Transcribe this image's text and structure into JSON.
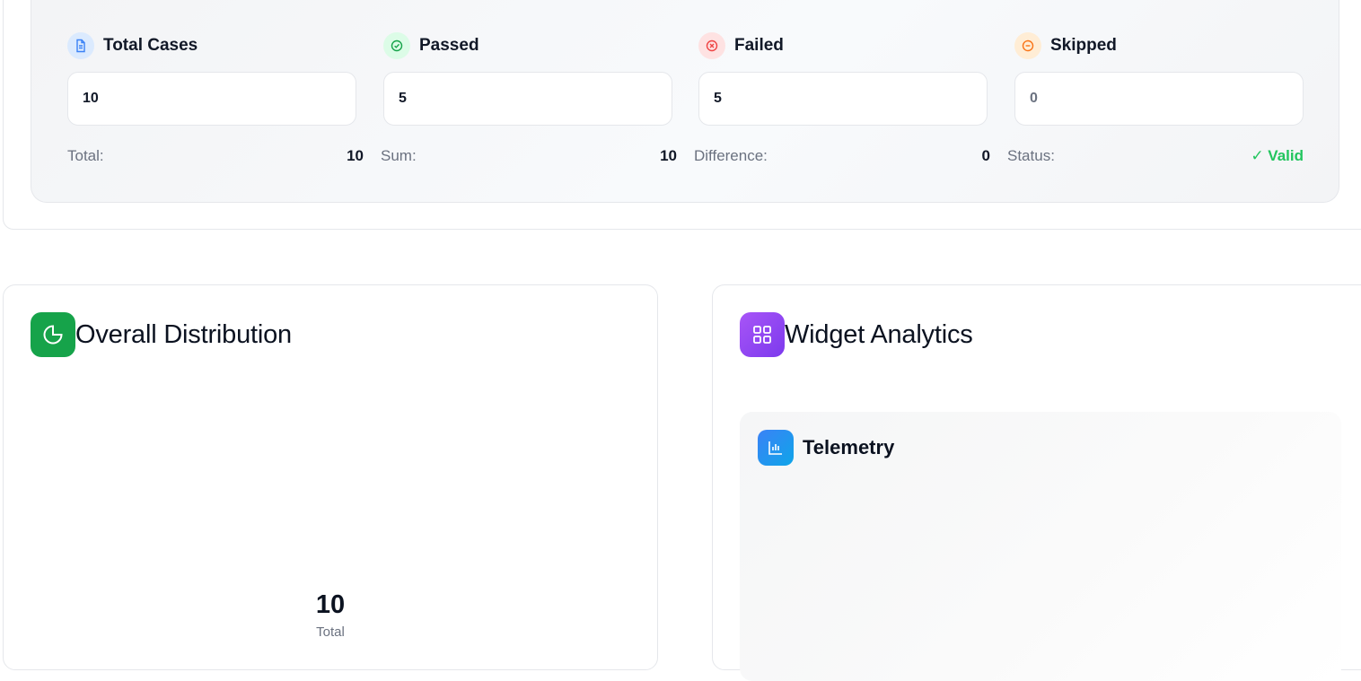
{
  "stats": [
    {
      "label": "Total Cases",
      "value": "10",
      "icon": "document-icon",
      "bg": "#dbeafe",
      "fg": "#3b82f6"
    },
    {
      "label": "Passed",
      "value": "5",
      "icon": "check-circle-icon",
      "bg": "#dcfce7",
      "fg": "#16a34a"
    },
    {
      "label": "Failed",
      "value": "5",
      "icon": "x-circle-icon",
      "bg": "#fee2e2",
      "fg": "#ef4444"
    },
    {
      "label": "Skipped",
      "value": "0",
      "icon": "minus-circle-icon",
      "bg": "#ffedd5",
      "fg": "#f97316"
    }
  ],
  "summary": [
    {
      "label": "Total:",
      "value": "10"
    },
    {
      "label": "Sum:",
      "value": "10"
    },
    {
      "label": "Difference:",
      "value": "0"
    },
    {
      "label": "Status:",
      "value": "✓ Valid"
    }
  ],
  "distribution": {
    "title": "Overall Distribution",
    "icon": "pie-chart-icon",
    "icon_color": "#16a34a",
    "total_value": "10",
    "total_label": "Total"
  },
  "widgets": {
    "title": "Widget Analytics",
    "icon": "grid-icon",
    "icon_color": "#8b5cf6",
    "telemetry": {
      "title": "Telemetry",
      "icon": "bar-chart-icon"
    }
  }
}
